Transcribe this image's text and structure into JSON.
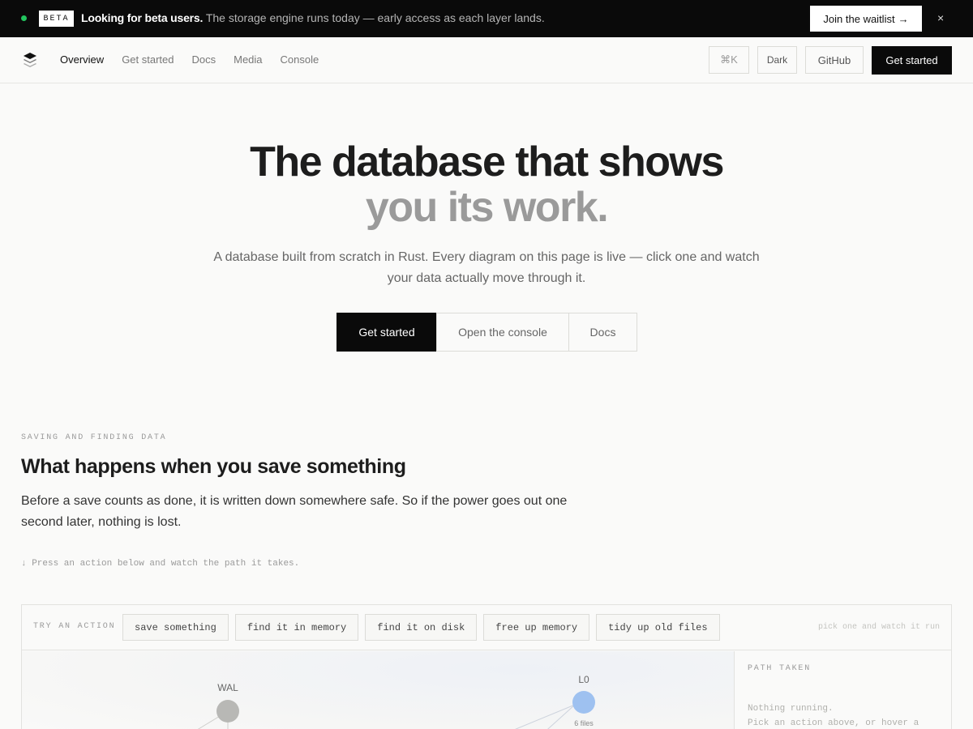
{
  "banner": {
    "badge": "BETA",
    "headline": "Looking for beta users.",
    "message": " The storage engine runs today — early access as each layer lands.",
    "cta_label": "Join the waitlist",
    "cta_arrow": "→",
    "close_glyph": "×",
    "status_color": "#22c55e"
  },
  "nav": {
    "links": [
      "Overview",
      "Get started",
      "Docs",
      "Media",
      "Console"
    ],
    "active_link": "Overview",
    "search_shortcut": "⌘K",
    "theme_label": "Dark",
    "github_label": "GitHub",
    "cta_label": "Get started"
  },
  "hero": {
    "title_line1": "The database that shows",
    "title_line2": "you its work.",
    "subtitle": "A database built from scratch in Rust. Every diagram on this page is live — click one and watch your data actually move through it.",
    "primary_cta": "Get started",
    "secondary_cta": "Open the console",
    "tertiary_cta": "Docs"
  },
  "section": {
    "eyebrow": "SAVING AND FINDING DATA",
    "title": "What happens when you save something",
    "body": "Before a save counts as done, it is written down somewhere safe. So if the power goes out one second later, nothing is lost.",
    "hint": "↓ Press an action below and watch the path it takes."
  },
  "panel": {
    "try_label": "TRY AN ACTION",
    "actions": [
      "save something",
      "find it in memory",
      "find it on disk",
      "free up memory",
      "tidy up old files"
    ],
    "pick_hint": "pick one and watch it run",
    "nodes": {
      "wal_label": "WAL",
      "l0_label": "L0",
      "l0_meta": "6 files"
    },
    "side_title": "PATH TAKEN",
    "side_status": "Nothing running.",
    "side_help": "Pick an action above, or hover a"
  },
  "colors": {
    "accent_dark": "#0a0a0a",
    "node_wal": "#b8b8b5",
    "node_l0": "#9ec1f0"
  }
}
